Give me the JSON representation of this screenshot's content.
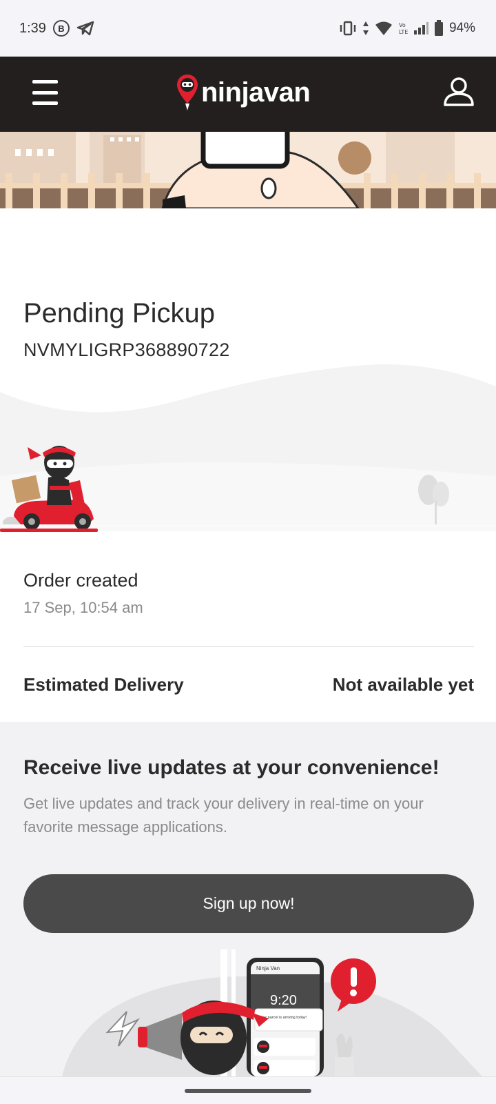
{
  "status_bar": {
    "time": "1:39",
    "b_badge": "B",
    "battery": "94%",
    "icons": [
      "vibrate-icon",
      "data-arrows-icon",
      "wifi-icon",
      "volte-icon",
      "signal-icon",
      "battery-icon"
    ]
  },
  "header": {
    "logo_text": "ninjavan",
    "menu_icon": "hamburger-icon",
    "profile_icon": "user-icon"
  },
  "shipment": {
    "status": "Pending Pickup",
    "tracking_id": "NVMYLIGRP368890722",
    "event_title": "Order created",
    "event_time": "17 Sep, 10:54 am",
    "estimated_label": "Estimated Delivery",
    "estimated_value": "Not available yet"
  },
  "updates": {
    "title": "Receive live updates at your convenience!",
    "description": "Get live updates and track your delivery in real-time on your favorite message applications.",
    "button_label": "Sign up now!",
    "phone_brand": "Ninja Van",
    "phone_time": "9:20",
    "phone_notification": "Your parcel is arriving today!"
  },
  "colors": {
    "header_bg": "#231f1f",
    "accent_red": "#e0202f",
    "button_bg": "#4a4a4a",
    "section_bg": "#f2f2f4"
  }
}
